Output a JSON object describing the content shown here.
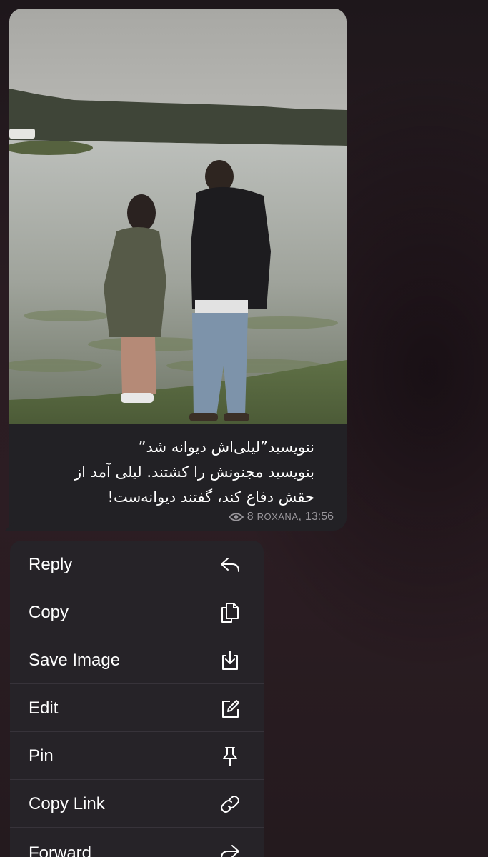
{
  "message": {
    "photo_alt": "couple standing by a lake",
    "caption_lines": [
      "ننویسید”لیلی‌اش دیوانه شد”",
      "بنویسید مجنونش را کشتند. لیلی آمد از",
      "حقش دفاع کند، گفتند دیوانه‌ست!"
    ],
    "views": "8",
    "author": "ROXANA",
    "time": "13:56"
  },
  "context_menu": {
    "items": [
      {
        "label": "Reply",
        "icon": "reply-icon"
      },
      {
        "label": "Copy",
        "icon": "copy-icon"
      },
      {
        "label": "Save Image",
        "icon": "save-image-icon"
      },
      {
        "label": "Edit",
        "icon": "edit-icon"
      },
      {
        "label": "Pin",
        "icon": "pin-icon"
      },
      {
        "label": "Copy Link",
        "icon": "link-icon"
      },
      {
        "label": "Forward",
        "icon": "forward-icon"
      }
    ]
  },
  "colors": {
    "bubble": "#222125",
    "menu": "#262328",
    "meta_text": "#9a979c"
  }
}
